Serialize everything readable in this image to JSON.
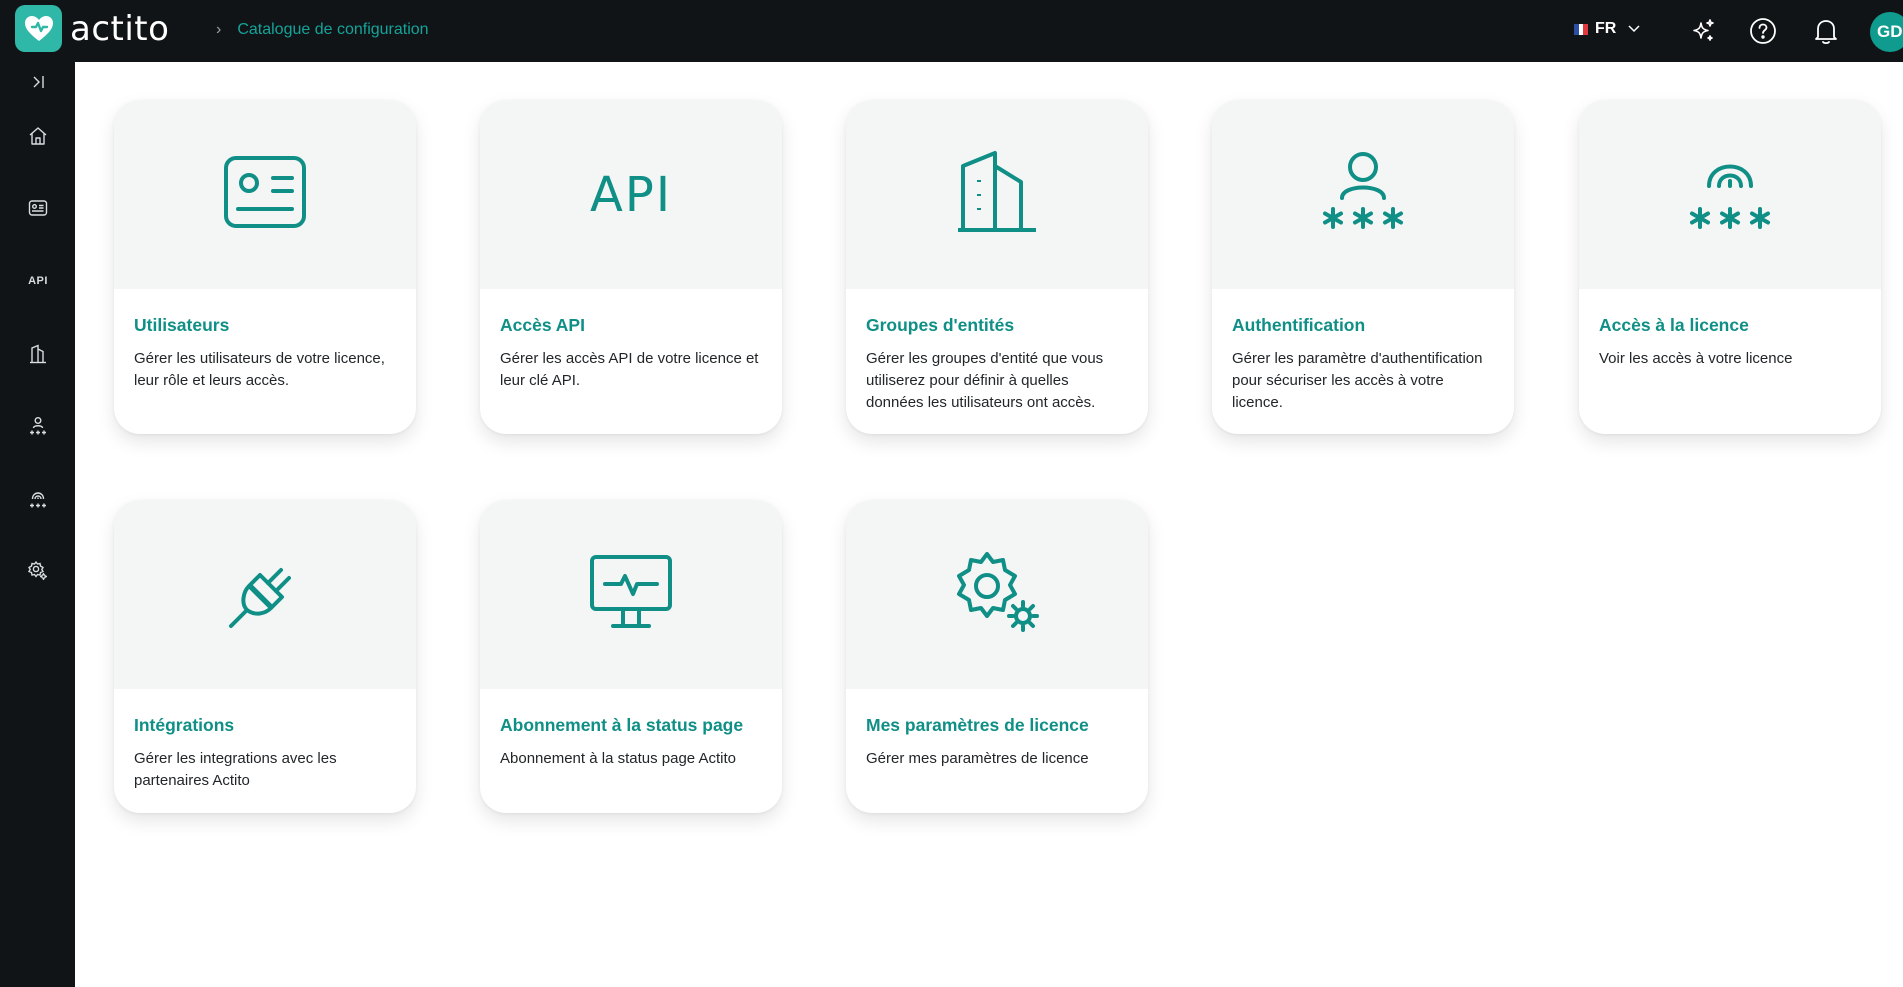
{
  "app": {
    "logo_text": "actito",
    "breadcrumb": "Catalogue de configuration"
  },
  "header": {
    "language": "FR",
    "avatar_initials": "GD"
  },
  "sidebar": {
    "api_label": "API"
  },
  "cards": [
    {
      "title": "Utilisateurs",
      "description": "Gérer les utilisateurs de votre licence, leur rôle et leurs accès.",
      "icon": "id-card-icon"
    },
    {
      "title": "Accès API",
      "description": "Gérer les accès API de votre licence et leur clé API.",
      "icon": "api-icon",
      "icon_text": "API"
    },
    {
      "title": "Groupes d'entités",
      "description": "Gérer les groupes d'entité que vous utiliserez pour définir à quelles données les utilisateurs ont accès.",
      "icon": "building-icon"
    },
    {
      "title": "Authentification",
      "description": "Gérer les paramètre d'authentification pour sécuriser les accès à votre licence.",
      "icon": "user-password-icon"
    },
    {
      "title": "Accès à la licence",
      "description": "Voir les accès à votre licence",
      "icon": "fingerprint-password-icon"
    },
    {
      "title": "Intégrations",
      "description": "Gérer les integrations avec les partenaires Actito",
      "icon": "plug-icon"
    },
    {
      "title": "Abonnement à la status page",
      "description": "Abonnement à la status page Actito",
      "icon": "monitor-pulse-icon"
    },
    {
      "title": "Mes paramètres de licence",
      "description": "Gérer mes paramètres de licence",
      "icon": "gears-icon"
    }
  ],
  "colors": {
    "accent": "#0f8f86",
    "topbar": "#111416",
    "logo": "#2fb7a8"
  }
}
